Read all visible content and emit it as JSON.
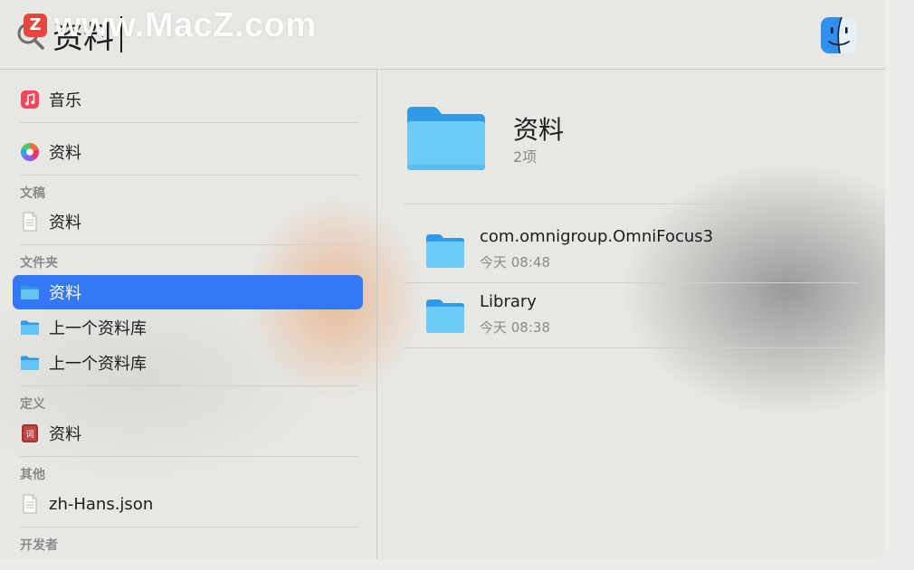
{
  "search": {
    "query": "资料"
  },
  "watermark": {
    "logo_letter": "Z",
    "text": "www.MacZ.com"
  },
  "results": [
    {
      "kind": "item",
      "label": "音乐",
      "icon": "music-app-icon"
    },
    {
      "kind": "item",
      "label": "资料",
      "icon": "color-wheel-icon"
    },
    {
      "kind": "section",
      "label": "文稿"
    },
    {
      "kind": "item",
      "label": "资料",
      "icon": "document-icon"
    },
    {
      "kind": "section",
      "label": "文件夹"
    },
    {
      "kind": "item",
      "label": "资料",
      "icon": "folder-icon",
      "selected": true
    },
    {
      "kind": "item",
      "label": "上一个资料库",
      "icon": "folder-icon"
    },
    {
      "kind": "item",
      "label": "上一个资料库",
      "icon": "folder-icon"
    },
    {
      "kind": "section",
      "label": "定义"
    },
    {
      "kind": "item",
      "label": "资料",
      "icon": "dictionary-icon"
    },
    {
      "kind": "section",
      "label": "其他"
    },
    {
      "kind": "item",
      "label": "zh-Hans.json",
      "icon": "document-icon"
    },
    {
      "kind": "section",
      "label": "开发者"
    }
  ],
  "preview": {
    "title": "资料",
    "count": "2项",
    "items": [
      {
        "name": "com.omnigroup.OmniFocus3",
        "time": "今天 08:48"
      },
      {
        "name": "Library",
        "time": "今天 08:38"
      }
    ]
  },
  "colors": {
    "selection": "#3478f6",
    "folder": "#5ab8ef"
  }
}
